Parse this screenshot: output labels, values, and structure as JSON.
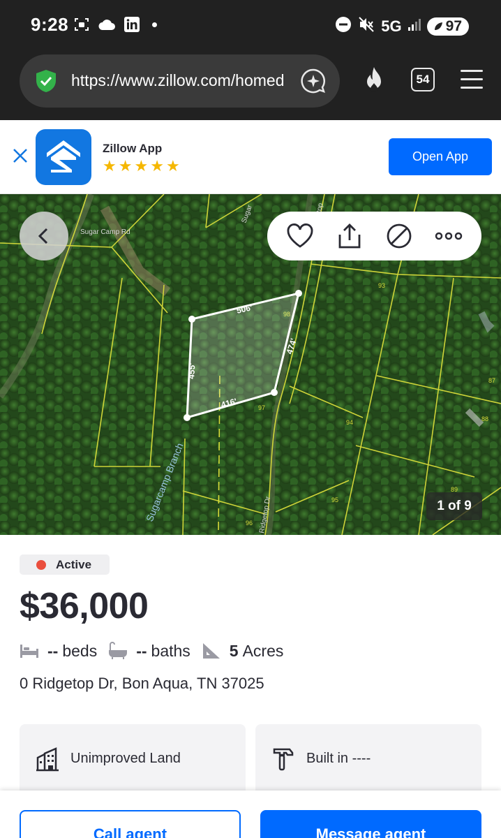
{
  "status_bar": {
    "time": "9:28",
    "network": "5G",
    "battery": "97"
  },
  "browser": {
    "url": "https://www.zillow.com/homed",
    "tab_count": "54"
  },
  "app_banner": {
    "app_name": "Zillow App",
    "rating_stars": 5,
    "open_label": "Open App"
  },
  "photo": {
    "counter": "1 of 9",
    "map_labels": {
      "edge_top": "506'",
      "edge_right": "474'",
      "edge_bottom": "416'",
      "edge_left": "455'",
      "road_sugar_camp": "Sugar Camp Rd",
      "road_sugar_top": "Sugar",
      "road_ridgetop_top": "getop",
      "road_ridgetop": "Ridgetop Dr",
      "creek": "Sugarcamp Branch",
      "lot_93": "93",
      "lot_98": "98",
      "lot_97": "97",
      "lot_94": "94",
      "lot_87": "87",
      "lot_88": "88",
      "lot_95": "95",
      "lot_96": "96",
      "lot_89": "89"
    }
  },
  "listing": {
    "status": "Active",
    "price": "$36,000",
    "beds_value": "--",
    "beds_label": "beds",
    "baths_value": "--",
    "baths_label": "baths",
    "lot_value": "5",
    "lot_label": "Acres",
    "address": "0 Ridgetop Dr, Bon Aqua, TN 37025"
  },
  "cards": {
    "type": "Unimproved Land",
    "built": "Built in ----"
  },
  "actions": {
    "call_label": "Call agent",
    "message_label": "Message agent"
  },
  "colors": {
    "brand_blue": "#006aff",
    "status_red": "#ea4e3d",
    "text_dark": "#2a2a33"
  }
}
